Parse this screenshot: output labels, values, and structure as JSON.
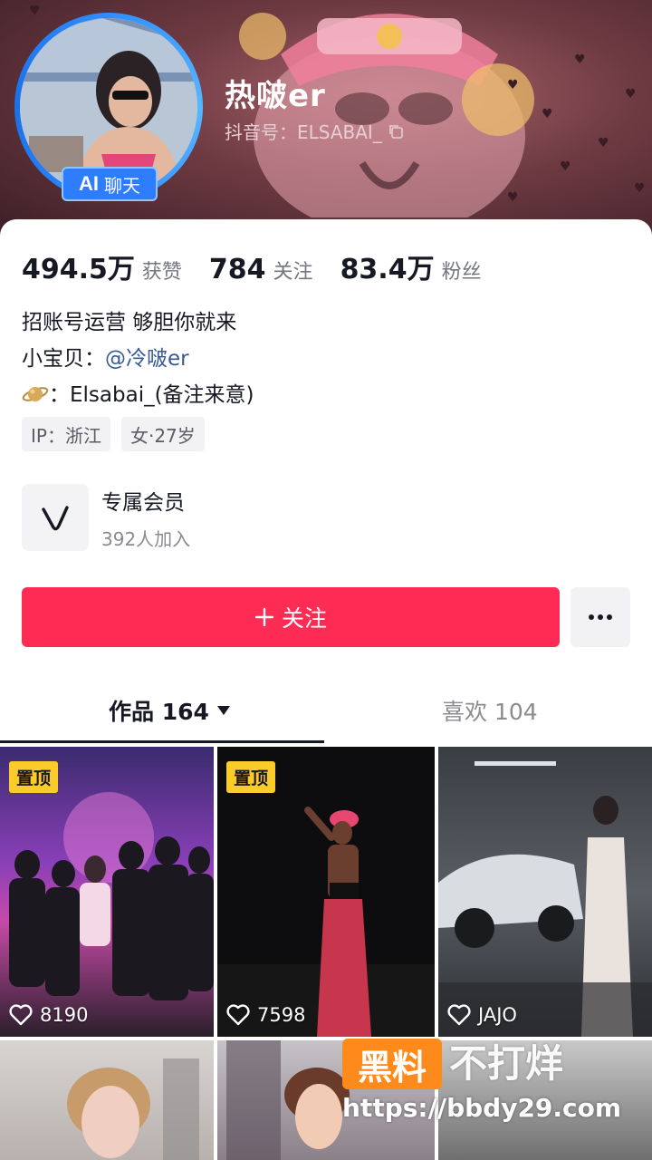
{
  "profile": {
    "display_name": "热啵er",
    "douyin_id": "抖音号：ELSABAI_",
    "ai_badge_ai": "AI",
    "ai_badge_text": "聊天"
  },
  "stats": [
    {
      "num": "494.5万",
      "label": "获赞"
    },
    {
      "num": "784",
      "label": "关注"
    },
    {
      "num": "83.4万",
      "label": "粉丝"
    }
  ],
  "bio": {
    "line1": "招账号运营 够胆你就来",
    "line2_prefix": "小宝贝：",
    "line2_mention": "@冷啵er",
    "line3": "：Elsabai_(备注来意)"
  },
  "tags": [
    "IP：浙江",
    "女·27岁"
  ],
  "member": {
    "title": "专属会员",
    "subtitle": "392人加入"
  },
  "actions": {
    "follow_label": "关注",
    "more_icon": "more-dots-icon"
  },
  "tabs": {
    "works": "作品 164",
    "likes": "喜欢 104"
  },
  "videos": [
    {
      "pinned": "置顶",
      "likes": "8190"
    },
    {
      "pinned": "置顶",
      "likes": "7598"
    },
    {
      "pinned": "",
      "likes": "JAJO"
    }
  ],
  "watermark": {
    "box": "黑料",
    "text": "不打烊",
    "url": "https://bbdy29.com"
  },
  "colors": {
    "accent": "#fe2c55",
    "pin": "#facc29",
    "badge": "#2f7dff"
  }
}
